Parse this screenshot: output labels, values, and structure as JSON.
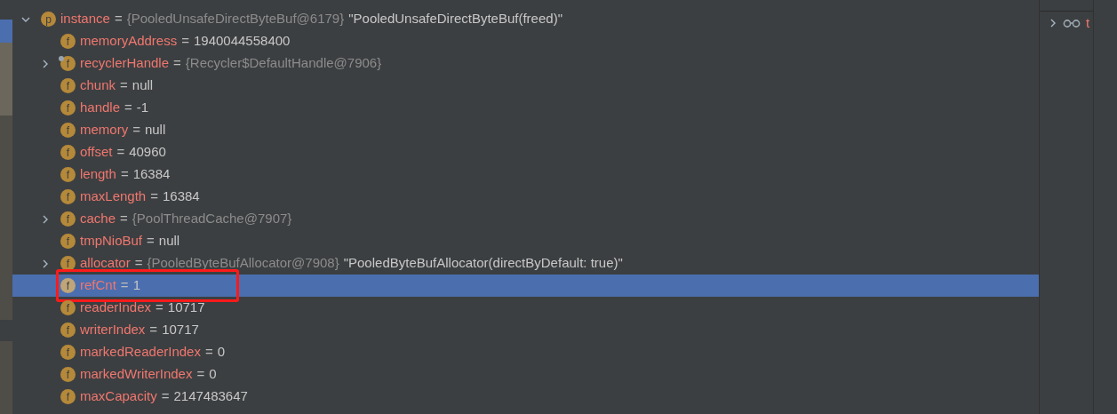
{
  "variables": [
    {
      "icon": "p",
      "name": "instance",
      "sign": "=",
      "type_ref": "{PooledUnsafeDirectByteBuf@6179}",
      "value": "\"PooledUnsafeDirectByteBuf(freed)\"",
      "expandable": true,
      "expanded": true,
      "selected": false,
      "children": [
        {
          "icon": "f",
          "name": "memoryAddress",
          "sign": "=",
          "value": "1940044558400",
          "expandable": false,
          "selected": false
        },
        {
          "icon": "f",
          "name": "recyclerHandle",
          "sign": "=",
          "type_ref": "{Recycler$DefaultHandle@7906}",
          "expandable": true,
          "expanded": false,
          "marked": true,
          "selected": false
        },
        {
          "icon": "f",
          "name": "chunk",
          "sign": "=",
          "value": "null",
          "expandable": false,
          "selected": false
        },
        {
          "icon": "f",
          "name": "handle",
          "sign": "=",
          "value": "-1",
          "expandable": false,
          "selected": false
        },
        {
          "icon": "f",
          "name": "memory",
          "sign": "=",
          "value": "null",
          "expandable": false,
          "selected": false
        },
        {
          "icon": "f",
          "name": "offset",
          "sign": "=",
          "value": "40960",
          "expandable": false,
          "selected": false
        },
        {
          "icon": "f",
          "name": "length",
          "sign": "=",
          "value": "16384",
          "expandable": false,
          "selected": false
        },
        {
          "icon": "f",
          "name": "maxLength",
          "sign": "=",
          "value": "16384",
          "expandable": false,
          "selected": false
        },
        {
          "icon": "f",
          "name": "cache",
          "sign": "=",
          "type_ref": "{PoolThreadCache@7907}",
          "expandable": true,
          "expanded": false,
          "selected": false
        },
        {
          "icon": "f",
          "name": "tmpNioBuf",
          "sign": "=",
          "value": "null",
          "expandable": false,
          "selected": false
        },
        {
          "icon": "f",
          "name": "allocator",
          "sign": "=",
          "type_ref": "{PooledByteBufAllocator@7908}",
          "value": "\"PooledByteBufAllocator(directByDefault: true)\"",
          "expandable": true,
          "expanded": false,
          "selected": false
        },
        {
          "icon": "f",
          "name": "refCnt",
          "sign": "=",
          "value": "1",
          "expandable": false,
          "selected": true,
          "highlighted": true
        },
        {
          "icon": "f",
          "name": "readerIndex",
          "sign": "=",
          "value": "10717",
          "expandable": false,
          "selected": false
        },
        {
          "icon": "f",
          "name": "writerIndex",
          "sign": "=",
          "value": "10717",
          "expandable": false,
          "selected": false
        },
        {
          "icon": "f",
          "name": "markedReaderIndex",
          "sign": "=",
          "value": "0",
          "expandable": false,
          "selected": false
        },
        {
          "icon": "f",
          "name": "markedWriterIndex",
          "sign": "=",
          "value": "0",
          "expandable": false,
          "selected": false
        },
        {
          "icon": "f",
          "name": "maxCapacity",
          "sign": "=",
          "value": "2147483647",
          "expandable": false,
          "selected": false
        }
      ]
    }
  ],
  "watches": [
    {
      "name": "t",
      "expandable": true,
      "expanded": false
    }
  ]
}
